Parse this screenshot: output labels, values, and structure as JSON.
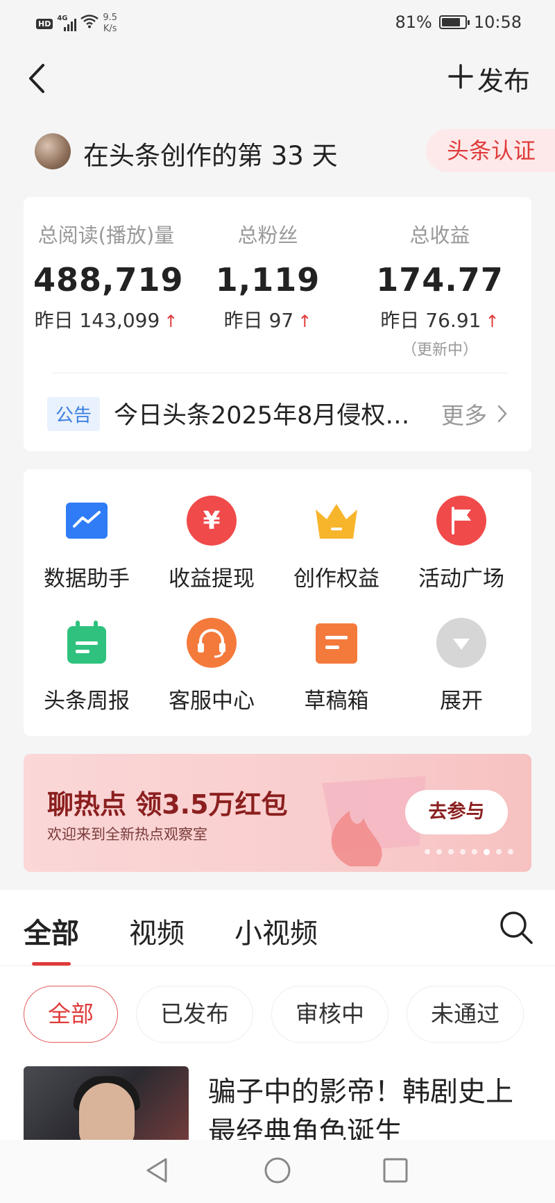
{
  "status_bar": {
    "hd": "HD",
    "network": "4G",
    "speed_value": "9.5",
    "speed_unit": "K/s",
    "battery": "81%",
    "battery_level": 0.81,
    "time": "10:58"
  },
  "header": {
    "back_icon": "chevron-left-icon",
    "publish_label": "发布"
  },
  "creator": {
    "title": "在头条创作的第 33 天",
    "badge": "头条认证"
  },
  "stats": [
    {
      "label": "总阅读(播放)量",
      "value": "488,719",
      "yesterday": "昨日 143,099",
      "note": ""
    },
    {
      "label": "总粉丝",
      "value": "1,119",
      "yesterday": "昨日 97",
      "note": ""
    },
    {
      "label": "总收益",
      "value": "174.77",
      "yesterday": "昨日 76.91",
      "note": "（更新中）"
    }
  ],
  "notice": {
    "tag": "公告",
    "text": "今日头条2025年8月侵权…",
    "more": "更多"
  },
  "tools": [
    {
      "label": "数据助手",
      "icon": "chart-icon",
      "color": "#2f7cf6"
    },
    {
      "label": "收益提现",
      "icon": "yuan-icon",
      "color": "#f04a4a"
    },
    {
      "label": "创作权益",
      "icon": "crown-icon",
      "color": "#f7b52c"
    },
    {
      "label": "活动广场",
      "icon": "flag-icon",
      "color": "#f04a4a"
    },
    {
      "label": "头条周报",
      "icon": "calendar-icon",
      "color": "#2ec27e"
    },
    {
      "label": "客服中心",
      "icon": "headset-icon",
      "color": "#f47a3c"
    },
    {
      "label": "草稿箱",
      "icon": "draft-icon",
      "color": "#f47a3c"
    },
    {
      "label": "展开",
      "icon": "expand-icon",
      "color": "#d6d6d6"
    }
  ],
  "banner": {
    "title": "聊热点 领3.5万红包",
    "subtitle": "欢迎来到全新热点观察室",
    "button": "去参与",
    "slides": 8,
    "active_slide": 5
  },
  "content_tabs": [
    "全部",
    "视频",
    "小视频"
  ],
  "filters": [
    "全部",
    "已发布",
    "审核中",
    "未通过"
  ],
  "article": {
    "title": "骗子中的影帝！韩剧史上最经典角色诞生"
  }
}
